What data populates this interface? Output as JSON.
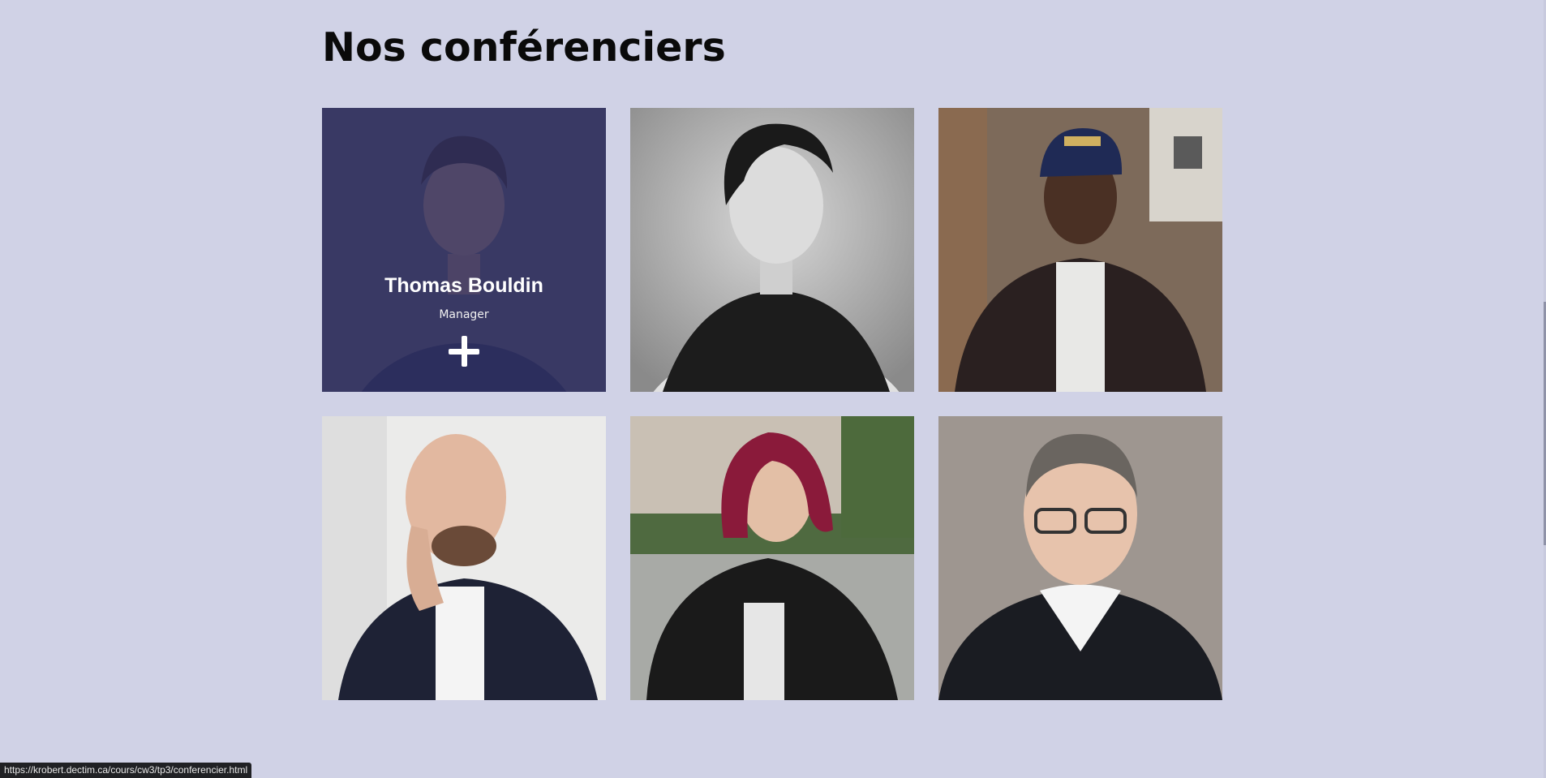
{
  "page": {
    "title": "Nos conférenciers",
    "background": "#d0d2e6"
  },
  "speakers": [
    {
      "name": "Thomas Bouldin",
      "role": "Manager",
      "hover": true
    },
    {
      "name": "",
      "role": "",
      "hover": false
    },
    {
      "name": "",
      "role": "",
      "hover": false
    },
    {
      "name": "",
      "role": "",
      "hover": false
    },
    {
      "name": "",
      "role": "",
      "hover": false
    },
    {
      "name": "",
      "role": "",
      "hover": false
    }
  ],
  "overlay": {
    "color": "#2d2d5f",
    "action_icon": "plus-icon"
  },
  "status_bar": {
    "url": "https://krobert.dectim.ca/cours/cw3/tp3/conferencier.html"
  }
}
